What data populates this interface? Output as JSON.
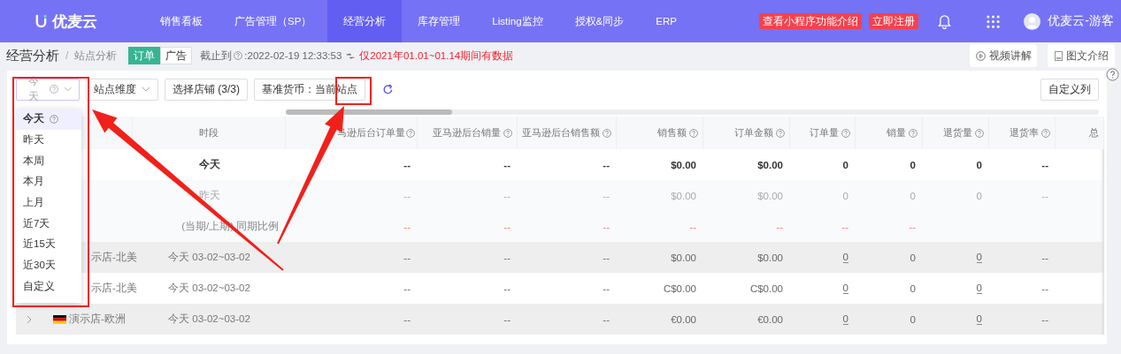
{
  "nav": {
    "logo": "优麦云",
    "items": [
      {
        "label": "销售看板",
        "selected": false
      },
      {
        "label": "广告管理（SP）",
        "selected": false
      },
      {
        "label": "经营分析",
        "selected": true
      },
      {
        "label": "库存管理",
        "selected": false
      },
      {
        "label": "Listing监控",
        "selected": false
      },
      {
        "label": "授权&同步",
        "selected": false
      },
      {
        "label": "ERP",
        "selected": false
      }
    ],
    "promo_buttons": [
      "查看小程序功能介绍",
      "立即注册"
    ],
    "user": "优麦云-游客"
  },
  "breadcrumb": {
    "section": "经营分析",
    "separator": "/",
    "page": "站点分析"
  },
  "data_toggle": [
    {
      "label": "订单",
      "selected": true
    },
    {
      "label": "广告",
      "selected": false
    }
  ],
  "cutoff": {
    "label": "截止到",
    "value": ":2022-02-19 12:33:53"
  },
  "notice": "仅2021年01.01~01.14期间有数据",
  "guide_buttons": [
    {
      "kind": "video",
      "label": "视频讲解"
    },
    {
      "kind": "doc",
      "label": "图文介绍"
    }
  ],
  "toolbar": {
    "date_select": {
      "value": "今天",
      "open": true
    },
    "dimension_select": "站点维度",
    "store_button": "选择店铺 (3/3)",
    "currency_button": "基准货币：当前站点",
    "custom_columns": "自定义列"
  },
  "date_options": [
    {
      "label": "今天",
      "selected": true,
      "help": true
    },
    {
      "label": "昨天",
      "selected": false,
      "help": false
    },
    {
      "label": "本周",
      "selected": false,
      "help": false
    },
    {
      "label": "本月",
      "selected": false,
      "help": false
    },
    {
      "label": "上月",
      "selected": false,
      "help": false
    },
    {
      "label": "近7天",
      "selected": false,
      "help": false
    },
    {
      "label": "近15天",
      "selected": false,
      "help": false
    },
    {
      "label": "近30天",
      "selected": false,
      "help": false
    },
    {
      "label": "自定义",
      "selected": false,
      "help": false
    }
  ],
  "table": {
    "columns": [
      {
        "label": "时段",
        "help": false
      },
      {
        "label": "马逊后台订单量",
        "help": true
      },
      {
        "label": "亚马逊后台销量",
        "help": true
      },
      {
        "label": "亚马逊后台销售额",
        "help": true
      },
      {
        "label": "销售额",
        "help": true
      },
      {
        "label": "订单金额",
        "help": true
      },
      {
        "label": "订单量",
        "help": true
      },
      {
        "label": "销量",
        "help": true
      },
      {
        "label": "退货量",
        "help": true
      },
      {
        "label": "退货率",
        "help": true
      },
      {
        "label": "总",
        "help": false
      }
    ],
    "summary_rows": [
      {
        "period": "今天",
        "kind": "current",
        "cells": [
          "--",
          "--",
          "--",
          "$0.00",
          "$0.00",
          "0",
          "0",
          "0",
          "--"
        ]
      },
      {
        "period": "昨天",
        "kind": "previous",
        "cells": [
          "--",
          "--",
          "--",
          "$0.00",
          "$0.00",
          "0",
          "0",
          "0",
          "--"
        ]
      },
      {
        "period": "(当期/上期)",
        "note": "同期比例",
        "kind": "ratio",
        "cells": [
          "--",
          "--",
          "--",
          "--",
          "--",
          "--",
          "--"
        ]
      }
    ],
    "store_rows": [
      {
        "expandable": false,
        "flag": false,
        "store": "示店-北美",
        "period": "今天 03-02~03-02",
        "cells": [
          {
            "text": "--",
            "underlined": false
          },
          {
            "text": "--",
            "underlined": false
          },
          {
            "text": "--",
            "underlined": false
          },
          {
            "text": "$0.00",
            "underlined": false
          },
          {
            "text": "$0.00",
            "underlined": false
          },
          {
            "text": "0",
            "underlined": true
          },
          {
            "text": "0",
            "underlined": false
          },
          {
            "text": "0",
            "underlined": true
          },
          {
            "text": "--",
            "underlined": false
          }
        ]
      },
      {
        "expandable": false,
        "flag": false,
        "store": "示店-北美",
        "period": "今天 03-02~03-02",
        "cells": [
          {
            "text": "--",
            "underlined": false
          },
          {
            "text": "--",
            "underlined": false
          },
          {
            "text": "--",
            "underlined": false
          },
          {
            "text": "C$0.00",
            "underlined": false
          },
          {
            "text": "C$0.00",
            "underlined": false
          },
          {
            "text": "0",
            "underlined": true
          },
          {
            "text": "0",
            "underlined": false
          },
          {
            "text": "0",
            "underlined": true
          },
          {
            "text": "--",
            "underlined": false
          }
        ]
      },
      {
        "expandable": true,
        "flag": true,
        "store": "演示店-欧洲",
        "period": "今天 03-02~03-02",
        "cells": [
          {
            "text": "--",
            "underlined": false
          },
          {
            "text": "--",
            "underlined": false
          },
          {
            "text": "--",
            "underlined": false
          },
          {
            "text": "€0.00",
            "underlined": false
          },
          {
            "text": "€0.00",
            "underlined": false
          },
          {
            "text": "0",
            "underlined": true
          },
          {
            "text": "0",
            "underlined": false
          },
          {
            "text": "0",
            "underlined": true
          },
          {
            "text": "--",
            "underlined": false
          }
        ]
      }
    ]
  }
}
